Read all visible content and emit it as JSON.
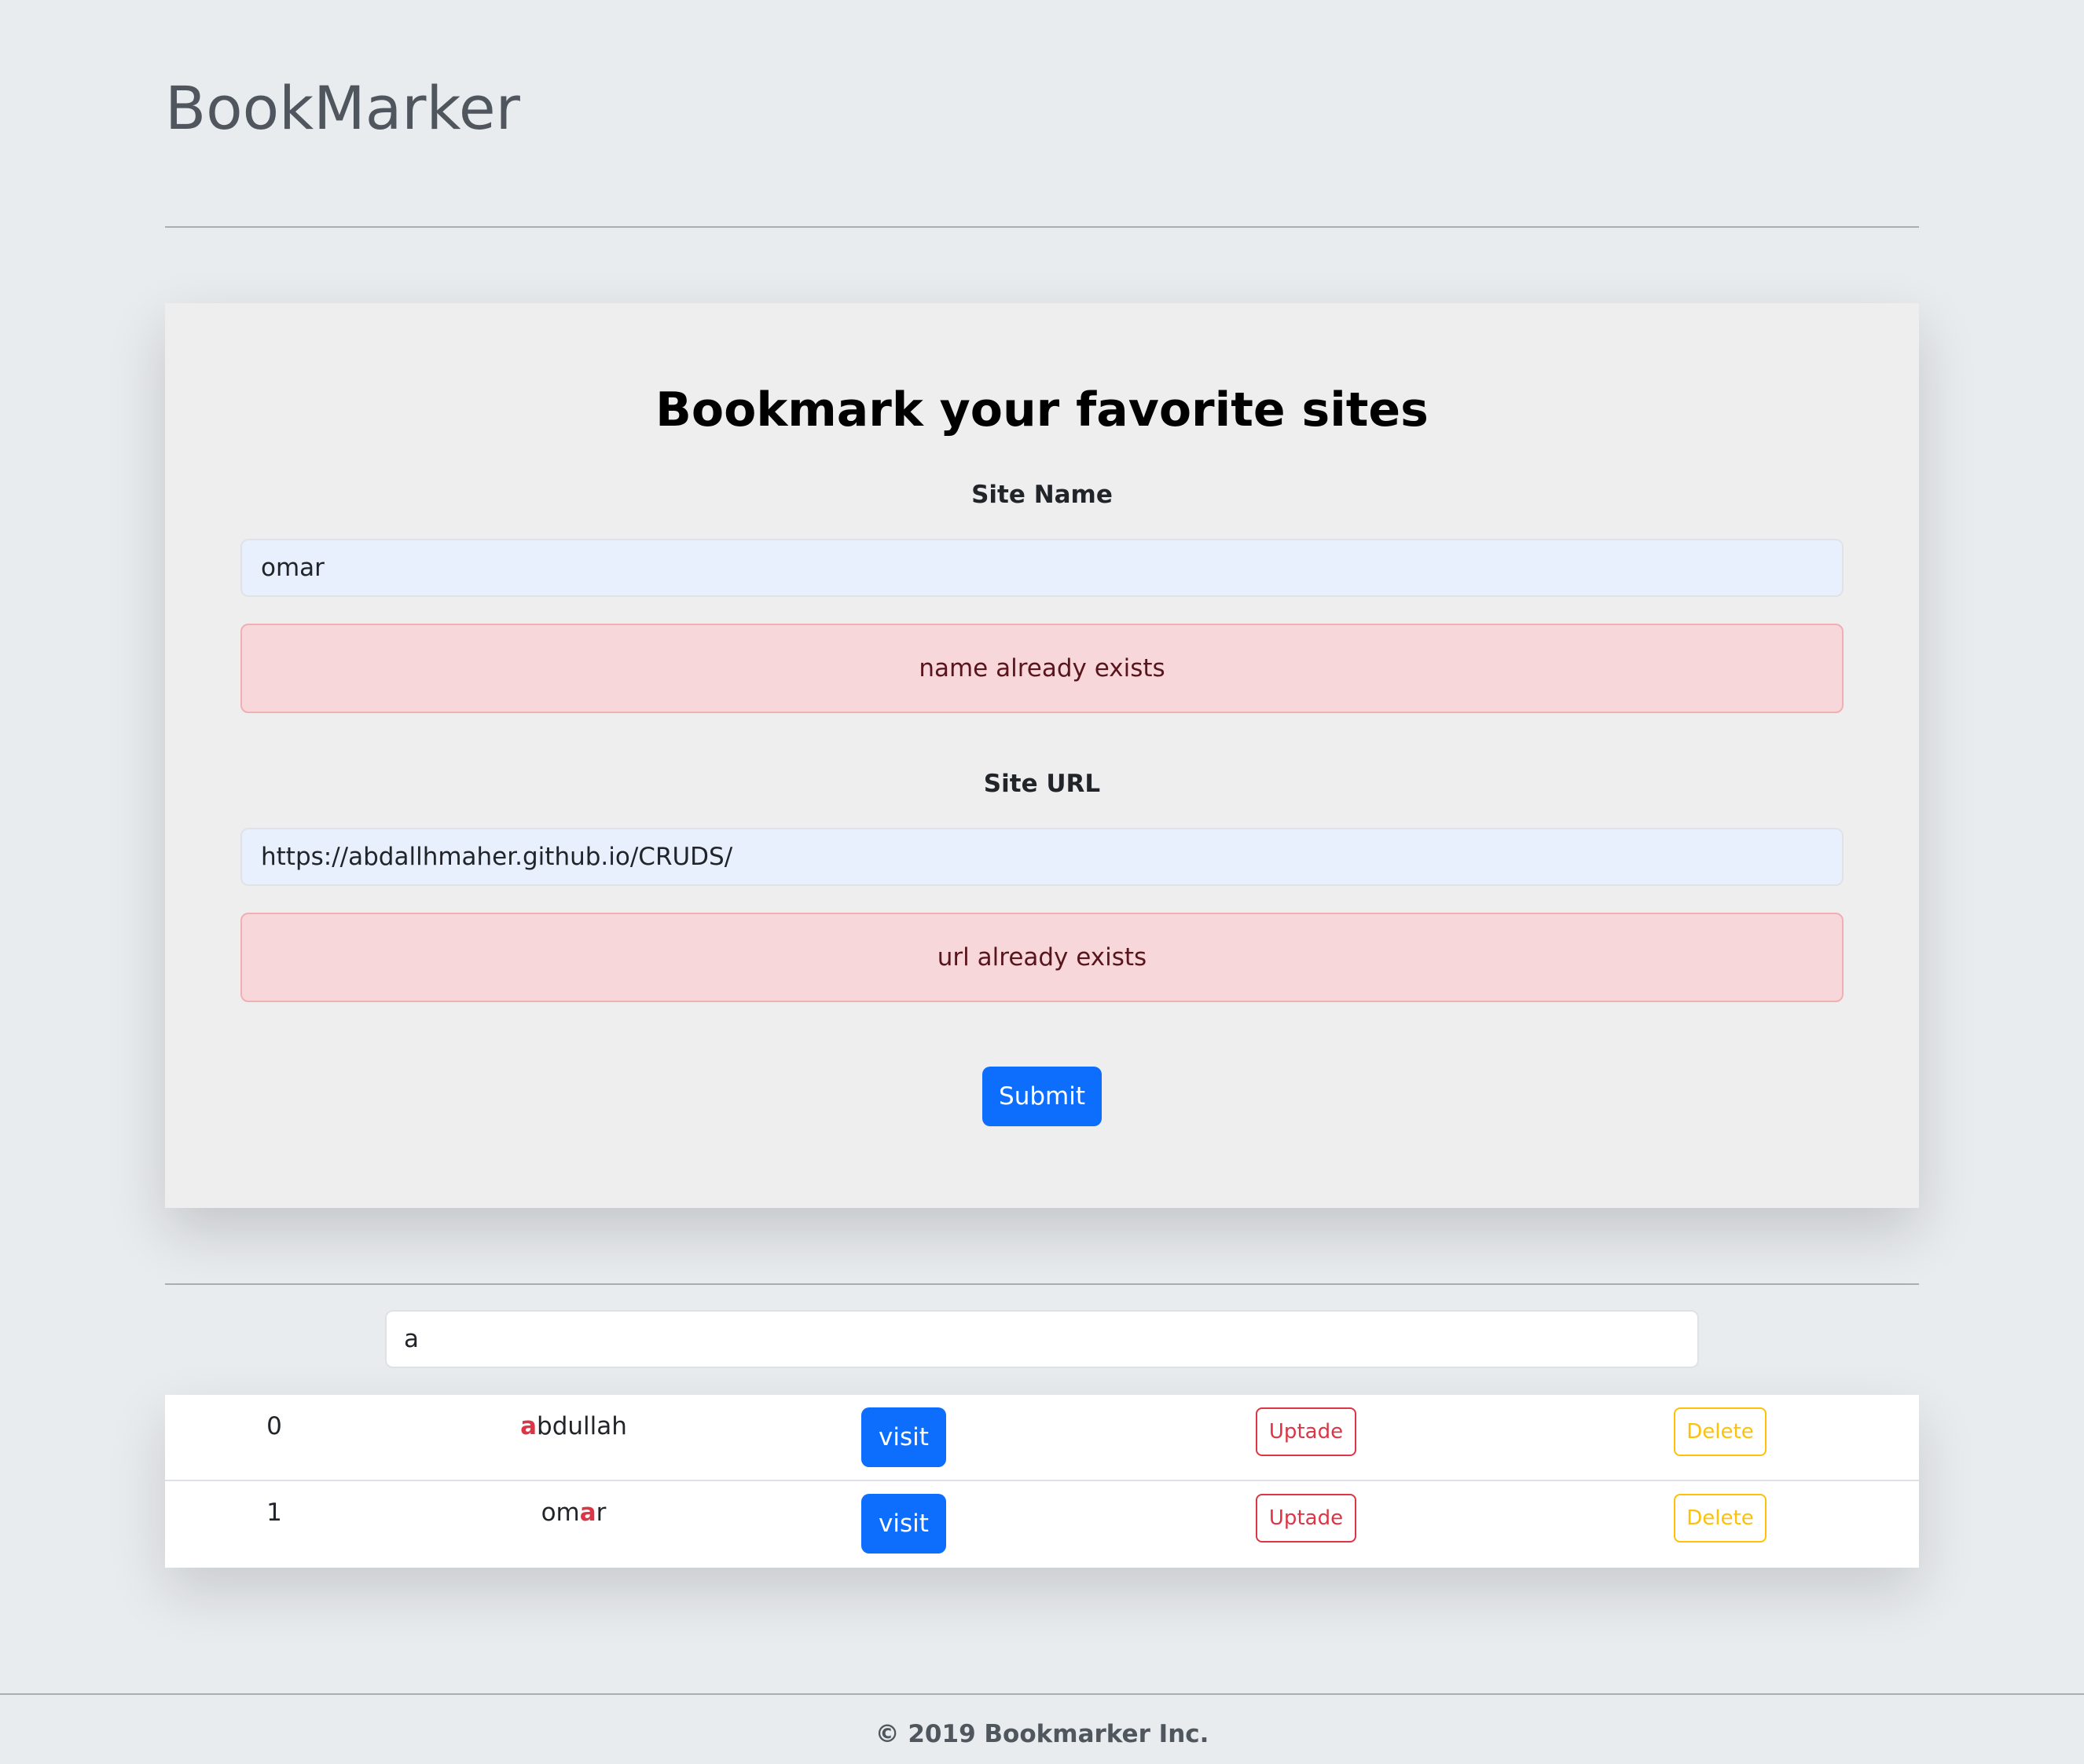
{
  "header": {
    "brand": "BookMarker"
  },
  "form": {
    "title": "Bookmark your favorite sites",
    "site_name_label": "Site Name",
    "site_name_value": "omar",
    "site_name_error": "name already exists",
    "site_url_label": "Site URL",
    "site_url_value": "https://abdallhmaher.github.io/CRUDS/",
    "site_url_error": "url already exists",
    "submit_label": "Submit"
  },
  "search": {
    "value": "a"
  },
  "table": {
    "rows": [
      {
        "index": "0",
        "name_highlight": "a",
        "name_rest_before": "",
        "name_rest_after": "bdullah",
        "visit_label": "visit",
        "update_label": "Uptade",
        "delete_label": "Delete"
      },
      {
        "index": "1",
        "name_highlight": "a",
        "name_rest_before": "om",
        "name_rest_after": "r",
        "visit_label": "visit",
        "update_label": "Uptade",
        "delete_label": "Delete"
      }
    ]
  },
  "footer": {
    "text": "© 2019 Bookmarker Inc."
  },
  "colors": {
    "primary": "#0d6efd",
    "danger": "#dc3545",
    "warning": "#ffc107",
    "alert_bg": "#f8d7da",
    "page_bg": "#e9ecef"
  }
}
